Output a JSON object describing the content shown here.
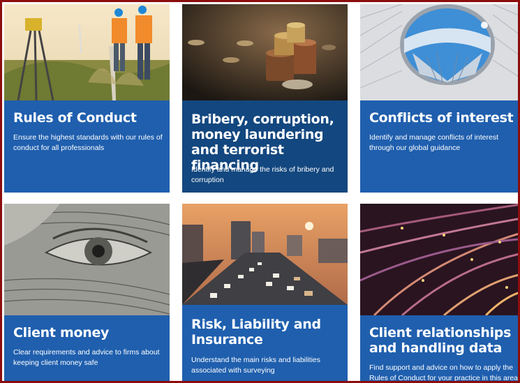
{
  "cards": [
    {
      "title": "Rules of Conduct",
      "desc": "Ensure the highest standards with our rules of conduct for all professionals"
    },
    {
      "title": "Bribery, corruption, money laundering and terrorist financing",
      "desc": "Identify and manage the risks of bribery and corruption"
    },
    {
      "title": "Conflicts of interest",
      "desc": "Identify and manage conflicts of interest through our global guidance"
    },
    {
      "title": "Client money",
      "desc": "Clear requirements and advice to firms about keeping client money safe"
    },
    {
      "title": "Risk, Liability and Insurance",
      "desc": "Understand the main risks and liabilities associated with surveying"
    },
    {
      "title": "Client relationships and handling data",
      "desc": "Find support and advice on how to apply the Rules of Conduct for your practice in this area"
    }
  ],
  "colors": {
    "panel": "#1f5fae",
    "panel_dark": "#13477f",
    "frame": "#8b0d0d"
  },
  "icons": [
    "surveyors-image",
    "coins-image",
    "building-atrium-image",
    "banknote-eye-image",
    "highway-city-image",
    "fiber-optics-image"
  ]
}
